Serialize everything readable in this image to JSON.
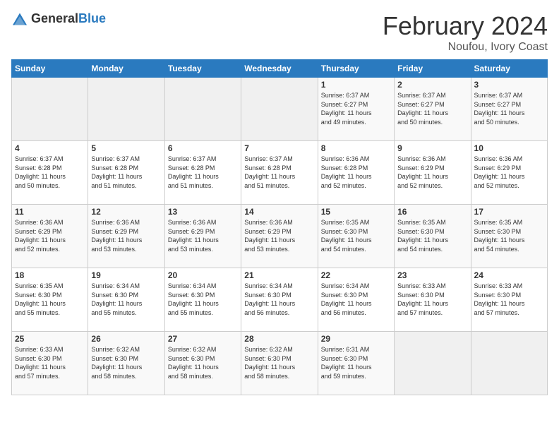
{
  "header": {
    "logo_general": "General",
    "logo_blue": "Blue",
    "title": "February 2024",
    "subtitle": "Noufou, Ivory Coast"
  },
  "weekdays": [
    "Sunday",
    "Monday",
    "Tuesday",
    "Wednesday",
    "Thursday",
    "Friday",
    "Saturday"
  ],
  "weeks": [
    [
      {
        "day": "",
        "info": ""
      },
      {
        "day": "",
        "info": ""
      },
      {
        "day": "",
        "info": ""
      },
      {
        "day": "",
        "info": ""
      },
      {
        "day": "1",
        "info": "Sunrise: 6:37 AM\nSunset: 6:27 PM\nDaylight: 11 hours\nand 49 minutes."
      },
      {
        "day": "2",
        "info": "Sunrise: 6:37 AM\nSunset: 6:27 PM\nDaylight: 11 hours\nand 50 minutes."
      },
      {
        "day": "3",
        "info": "Sunrise: 6:37 AM\nSunset: 6:27 PM\nDaylight: 11 hours\nand 50 minutes."
      }
    ],
    [
      {
        "day": "4",
        "info": "Sunrise: 6:37 AM\nSunset: 6:28 PM\nDaylight: 11 hours\nand 50 minutes."
      },
      {
        "day": "5",
        "info": "Sunrise: 6:37 AM\nSunset: 6:28 PM\nDaylight: 11 hours\nand 51 minutes."
      },
      {
        "day": "6",
        "info": "Sunrise: 6:37 AM\nSunset: 6:28 PM\nDaylight: 11 hours\nand 51 minutes."
      },
      {
        "day": "7",
        "info": "Sunrise: 6:37 AM\nSunset: 6:28 PM\nDaylight: 11 hours\nand 51 minutes."
      },
      {
        "day": "8",
        "info": "Sunrise: 6:36 AM\nSunset: 6:28 PM\nDaylight: 11 hours\nand 52 minutes."
      },
      {
        "day": "9",
        "info": "Sunrise: 6:36 AM\nSunset: 6:29 PM\nDaylight: 11 hours\nand 52 minutes."
      },
      {
        "day": "10",
        "info": "Sunrise: 6:36 AM\nSunset: 6:29 PM\nDaylight: 11 hours\nand 52 minutes."
      }
    ],
    [
      {
        "day": "11",
        "info": "Sunrise: 6:36 AM\nSunset: 6:29 PM\nDaylight: 11 hours\nand 52 minutes."
      },
      {
        "day": "12",
        "info": "Sunrise: 6:36 AM\nSunset: 6:29 PM\nDaylight: 11 hours\nand 53 minutes."
      },
      {
        "day": "13",
        "info": "Sunrise: 6:36 AM\nSunset: 6:29 PM\nDaylight: 11 hours\nand 53 minutes."
      },
      {
        "day": "14",
        "info": "Sunrise: 6:36 AM\nSunset: 6:29 PM\nDaylight: 11 hours\nand 53 minutes."
      },
      {
        "day": "15",
        "info": "Sunrise: 6:35 AM\nSunset: 6:30 PM\nDaylight: 11 hours\nand 54 minutes."
      },
      {
        "day": "16",
        "info": "Sunrise: 6:35 AM\nSunset: 6:30 PM\nDaylight: 11 hours\nand 54 minutes."
      },
      {
        "day": "17",
        "info": "Sunrise: 6:35 AM\nSunset: 6:30 PM\nDaylight: 11 hours\nand 54 minutes."
      }
    ],
    [
      {
        "day": "18",
        "info": "Sunrise: 6:35 AM\nSunset: 6:30 PM\nDaylight: 11 hours\nand 55 minutes."
      },
      {
        "day": "19",
        "info": "Sunrise: 6:34 AM\nSunset: 6:30 PM\nDaylight: 11 hours\nand 55 minutes."
      },
      {
        "day": "20",
        "info": "Sunrise: 6:34 AM\nSunset: 6:30 PM\nDaylight: 11 hours\nand 55 minutes."
      },
      {
        "day": "21",
        "info": "Sunrise: 6:34 AM\nSunset: 6:30 PM\nDaylight: 11 hours\nand 56 minutes."
      },
      {
        "day": "22",
        "info": "Sunrise: 6:34 AM\nSunset: 6:30 PM\nDaylight: 11 hours\nand 56 minutes."
      },
      {
        "day": "23",
        "info": "Sunrise: 6:33 AM\nSunset: 6:30 PM\nDaylight: 11 hours\nand 57 minutes."
      },
      {
        "day": "24",
        "info": "Sunrise: 6:33 AM\nSunset: 6:30 PM\nDaylight: 11 hours\nand 57 minutes."
      }
    ],
    [
      {
        "day": "25",
        "info": "Sunrise: 6:33 AM\nSunset: 6:30 PM\nDaylight: 11 hours\nand 57 minutes."
      },
      {
        "day": "26",
        "info": "Sunrise: 6:32 AM\nSunset: 6:30 PM\nDaylight: 11 hours\nand 58 minutes."
      },
      {
        "day": "27",
        "info": "Sunrise: 6:32 AM\nSunset: 6:30 PM\nDaylight: 11 hours\nand 58 minutes."
      },
      {
        "day": "28",
        "info": "Sunrise: 6:32 AM\nSunset: 6:30 PM\nDaylight: 11 hours\nand 58 minutes."
      },
      {
        "day": "29",
        "info": "Sunrise: 6:31 AM\nSunset: 6:30 PM\nDaylight: 11 hours\nand 59 minutes."
      },
      {
        "day": "",
        "info": ""
      },
      {
        "day": "",
        "info": ""
      }
    ]
  ]
}
